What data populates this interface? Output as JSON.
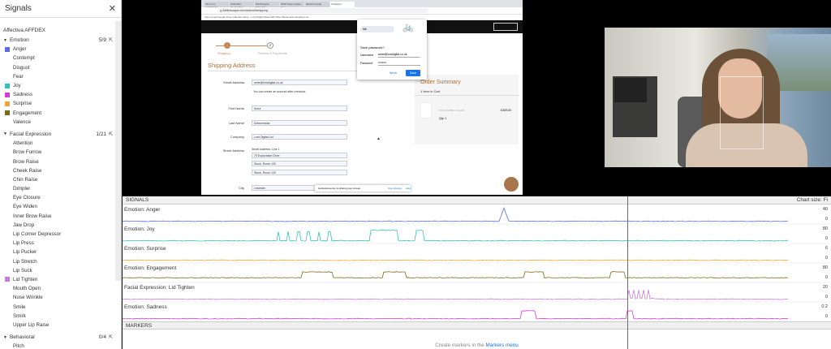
{
  "sidebar": {
    "title": "Signals",
    "subtitle": "Affectiva AFFDEX",
    "groups": [
      {
        "name": "Emotion",
        "count": "5/9",
        "items": [
          {
            "label": "Anger",
            "color": "#5b6ee1"
          },
          {
            "label": "Contempt",
            "color": ""
          },
          {
            "label": "Disgust",
            "color": ""
          },
          {
            "label": "Fear",
            "color": ""
          },
          {
            "label": "Joy",
            "color": "#2ec4b6"
          },
          {
            "label": "Sadness",
            "color": "#d63ad6"
          },
          {
            "label": "Surprise",
            "color": "#f0a630"
          },
          {
            "label": "Engagement",
            "color": "#7a6b1a"
          },
          {
            "label": "Valence",
            "color": ""
          }
        ]
      },
      {
        "name": "Facial Expression",
        "count": "1/21",
        "items": [
          {
            "label": "Attention",
            "color": ""
          },
          {
            "label": "Brow Furrow",
            "color": ""
          },
          {
            "label": "Brow Raise",
            "color": ""
          },
          {
            "label": "Cheek Raise",
            "color": ""
          },
          {
            "label": "Chin Raise",
            "color": ""
          },
          {
            "label": "Dimpler",
            "color": ""
          },
          {
            "label": "Eye Closure",
            "color": ""
          },
          {
            "label": "Eye Widen",
            "color": ""
          },
          {
            "label": "Inner Brow Raise",
            "color": ""
          },
          {
            "label": "Jaw Drop",
            "color": ""
          },
          {
            "label": "Lip Corner Depressor",
            "color": ""
          },
          {
            "label": "Lip Press",
            "color": ""
          },
          {
            "label": "Lip Pucker",
            "color": ""
          },
          {
            "label": "Lip Stretch",
            "color": ""
          },
          {
            "label": "Lip Suck",
            "color": ""
          },
          {
            "label": "Lid Tighten",
            "color": "#c77ddb"
          },
          {
            "label": "Mouth Open",
            "color": ""
          },
          {
            "label": "Nose Wrinkle",
            "color": ""
          },
          {
            "label": "Smile",
            "color": ""
          },
          {
            "label": "Smirk",
            "color": ""
          },
          {
            "label": "Upper Lip Raise",
            "color": ""
          }
        ]
      },
      {
        "name": "Behavioral",
        "count": "0/4",
        "items": [
          {
            "label": "Pitch",
            "color": ""
          }
        ]
      }
    ]
  },
  "screen": {
    "tabs": [
      "Inbox (1) - amirablack...",
      "Pofile Bot pp_Genting...",
      "WAP Events Schedule...",
      "WAP Video Invites - Goo...",
      "iMotions study",
      "Checkout"
    ],
    "url": "g.3dblinkscape.uk/checkout/#shipping",
    "bookmarks": "Apps  Gmail  Google Drive  Calendar  Work - Lord Digital  Slack  WR  Other Bookmarks  Reading List",
    "step1": "Shipping",
    "step2": "Review & Payments",
    "step2_num": "2",
    "shipping_title": "Shipping Address",
    "fields": [
      {
        "label": "Email Address",
        "value": "amie@lorddigital.co.uk"
      },
      {
        "label": "First Name",
        "value": "Anna"
      },
      {
        "label": "Last Name",
        "value": "Doborowska"
      },
      {
        "label": "Company",
        "value": "Lord Digital Ltd"
      },
      {
        "label": "Street Address",
        "value": "75 Exploration Drive"
      },
      {
        "label": "",
        "value": "Stock, Room 120"
      },
      {
        "label": "",
        "value": "Stock, Room 120"
      },
      {
        "label": "City",
        "value": "Leicester"
      }
    ],
    "street_line_label": "Street Address: Line 1",
    "hint": "You can create an account after checkout.",
    "summary_title": "Order Summary",
    "summary_items": "1 Item in Cart",
    "product_name": "PRO SCRIBE COLLAB",
    "product_price": "£339.00",
    "product_qty": "Qty: 1",
    "popup_title": "Save password?",
    "popup_user_label": "Username",
    "popup_user": "amie@lorddigital.co.uk",
    "popup_pass_label": "Password",
    "popup_pass": "••••••••",
    "popup_never": "Never",
    "popup_save": "Save",
    "toggle_label": "Me",
    "share_msg": "iw.idestiona.com is sharing your screen.",
    "share_stop": "Stop sharing",
    "share_hide": "Hide"
  },
  "signals": {
    "title": "SIGNALS",
    "chart_size": "Chart size: Fi",
    "tracks": [
      {
        "label": "Emotion: Anger",
        "color": "#5b6ee1",
        "max": "40",
        "min": "0"
      },
      {
        "label": "Emotion: Joy",
        "color": "#2ec4b6",
        "max": "80",
        "min": "0"
      },
      {
        "label": "Emotion: Surprise",
        "color": "#f0a630",
        "max": "6",
        "min": "0"
      },
      {
        "label": "Emotion: Engagement",
        "color": "#7a6b1a",
        "max": "80",
        "min": "0"
      },
      {
        "label": "Facial Expression: Lid Tighten",
        "color": "#c77ddb",
        "max": "20",
        "min": "0"
      },
      {
        "label": "Emotion: Sadness",
        "color": "#d63ad6",
        "max": "0.2",
        "min": "0"
      }
    ]
  },
  "markers": {
    "title": "MARKERS",
    "msg_pre": "Create markers in the ",
    "msg_link": "Markers menu"
  }
}
